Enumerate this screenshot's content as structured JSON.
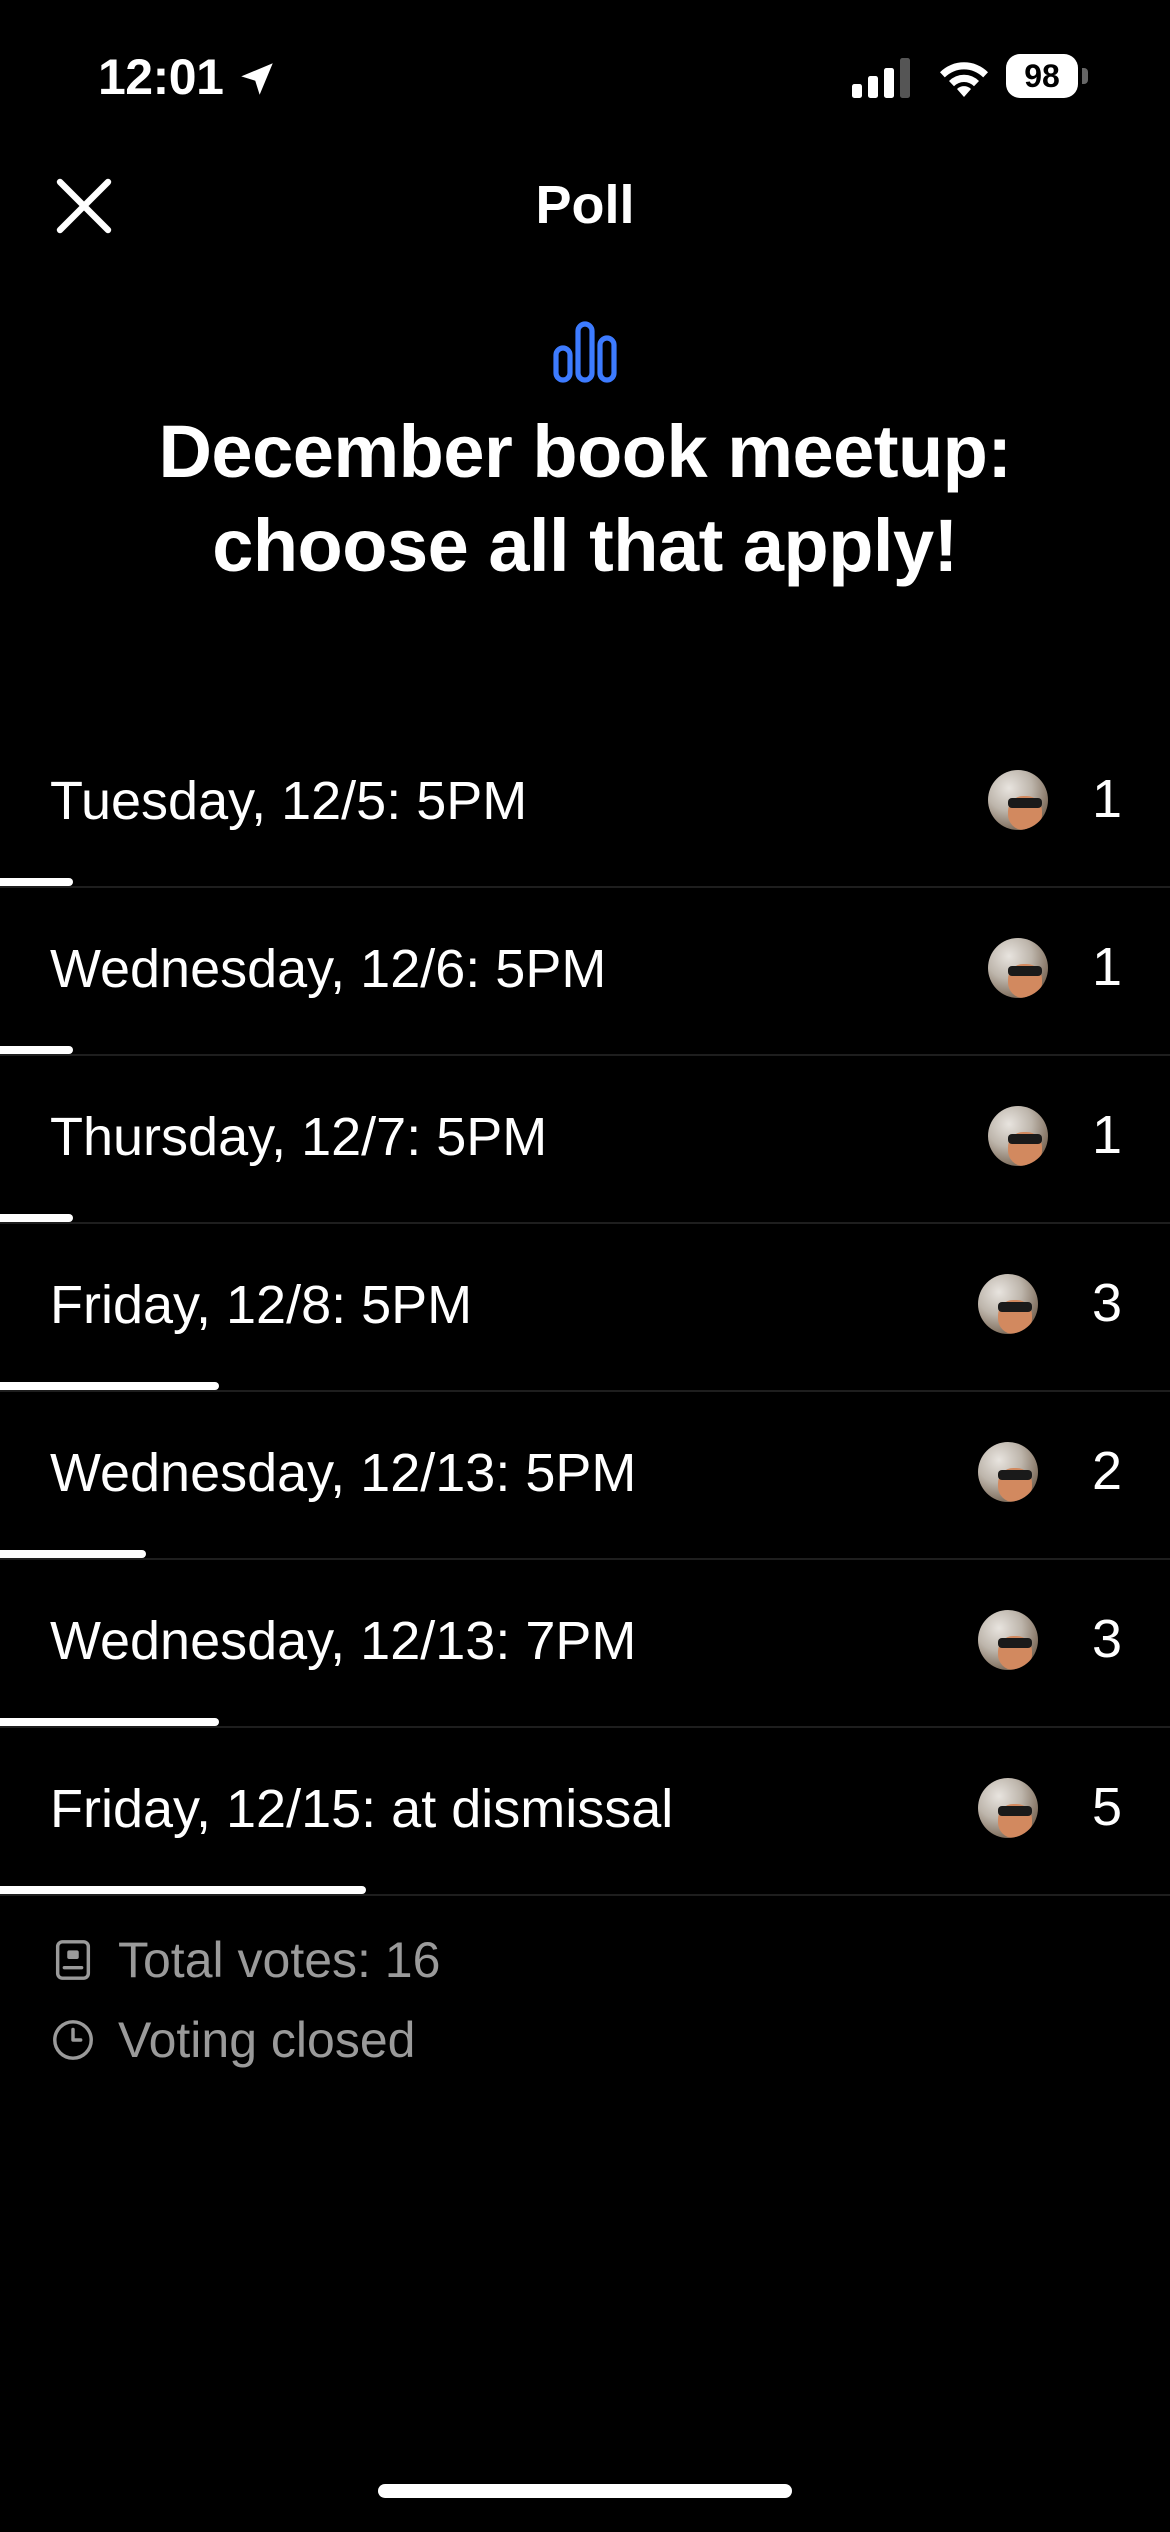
{
  "status_bar": {
    "time": "12:01",
    "battery": "98"
  },
  "header": {
    "title": "Poll",
    "close_icon": "close-icon"
  },
  "poll": {
    "icon": "poll-icon",
    "question": "December book meetup: choose all that apply!",
    "options": [
      {
        "label": "Tuesday, 12/5: 5PM",
        "count": "1",
        "votes": 1
      },
      {
        "label": "Wednesday, 12/6: 5PM",
        "count": "1",
        "votes": 1
      },
      {
        "label": "Thursday, 12/7: 5PM",
        "count": "1",
        "votes": 1
      },
      {
        "label": "Friday, 12/8: 5PM",
        "count": "3",
        "votes": 3
      },
      {
        "label": "Wednesday, 12/13: 5PM",
        "count": "2",
        "votes": 2
      },
      {
        "label": "Wednesday, 12/13: 7PM",
        "count": "3",
        "votes": 3
      },
      {
        "label": "Friday, 12/15: at dismissal",
        "count": "5",
        "votes": 5
      }
    ],
    "total_votes": "Total votes: 16",
    "total_votes_value": 16,
    "status": "Voting closed"
  },
  "colors": {
    "background": "#000000",
    "text": "#ffffff",
    "muted_text": "#9a9a9a",
    "accent": "#3d7bff",
    "divider": "#1e1e1e"
  }
}
